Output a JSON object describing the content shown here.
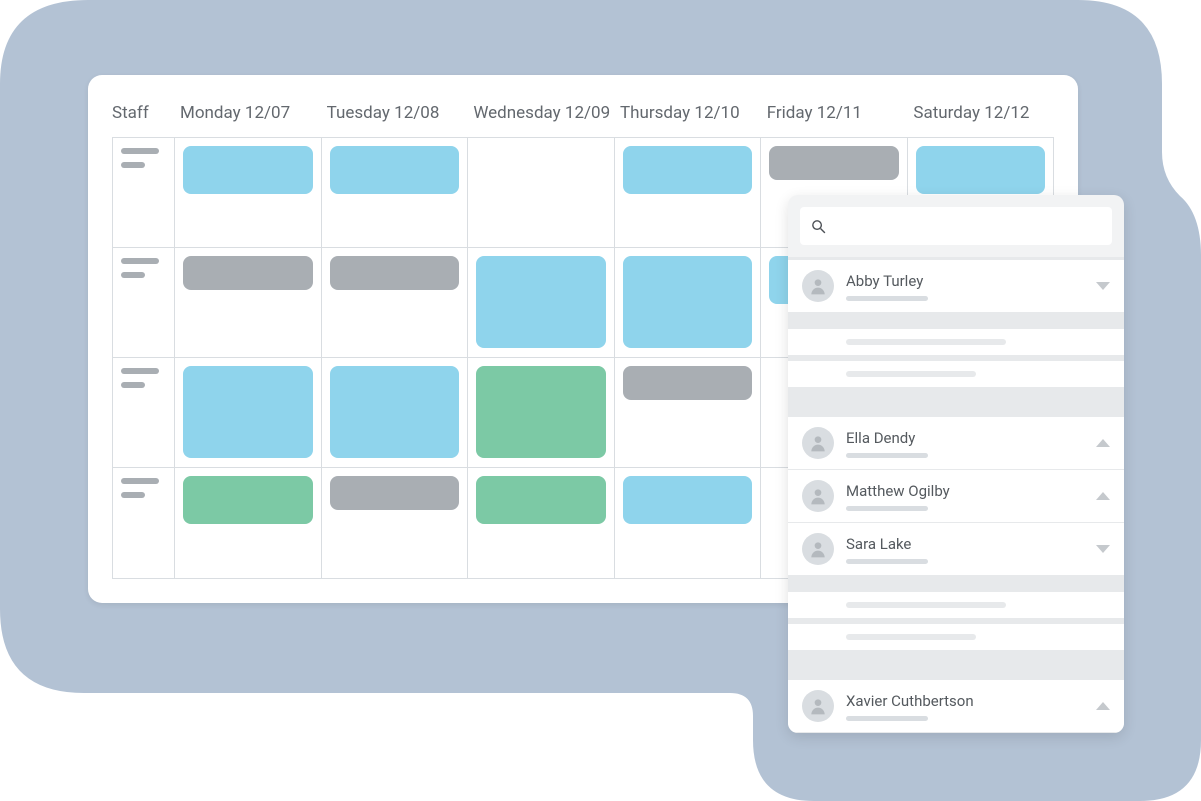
{
  "calendar": {
    "staff_label": "Staff",
    "days": [
      "Monday 12/07",
      "Tuesday 12/08",
      "Wednesday 12/09",
      "Thursday 12/10",
      "Friday 12/11",
      "Saturday 12/12"
    ],
    "rows": [
      {
        "cells": [
          {
            "color": "blue",
            "h": "half"
          },
          {
            "color": "blue",
            "h": "half"
          },
          {
            "color": null
          },
          {
            "color": "blue",
            "h": "half"
          },
          {
            "color": "gray",
            "h": "third"
          },
          {
            "color": "blue",
            "h": "half"
          }
        ]
      },
      {
        "cells": [
          {
            "color": "gray",
            "h": "third"
          },
          {
            "color": "gray",
            "h": "third"
          },
          {
            "color": "blue",
            "h": "full"
          },
          {
            "color": "blue",
            "h": "full"
          },
          {
            "color": "blue",
            "h": "half"
          },
          {
            "color": null
          }
        ]
      },
      {
        "cells": [
          {
            "color": "blue",
            "h": "full"
          },
          {
            "color": "blue",
            "h": "full"
          },
          {
            "color": "green",
            "h": "full"
          },
          {
            "color": "gray",
            "h": "third"
          },
          {
            "color": null
          },
          {
            "color": null
          }
        ]
      },
      {
        "cells": [
          {
            "color": "green",
            "h": "half"
          },
          {
            "color": "gray",
            "h": "third"
          },
          {
            "color": "green",
            "h": "half"
          },
          {
            "color": "blue",
            "h": "half"
          },
          {
            "color": null
          },
          {
            "color": null
          }
        ]
      }
    ]
  },
  "people_panel": {
    "search_placeholder": "",
    "people": [
      {
        "name": "Abby Turley",
        "expanded": true,
        "details": 2
      },
      {
        "name": "Ella Dendy",
        "expanded": false
      },
      {
        "name": "Matthew Ogilby",
        "expanded": false
      },
      {
        "name": "Sara Lake",
        "expanded": true,
        "details": 2
      },
      {
        "name": "Xavier Cuthbertson",
        "expanded": false
      }
    ]
  },
  "colors": {
    "blue": "#8fd4ec",
    "green": "#7cc9a5",
    "gray": "#a9aeb3",
    "backdrop": "#b3c2d4"
  }
}
